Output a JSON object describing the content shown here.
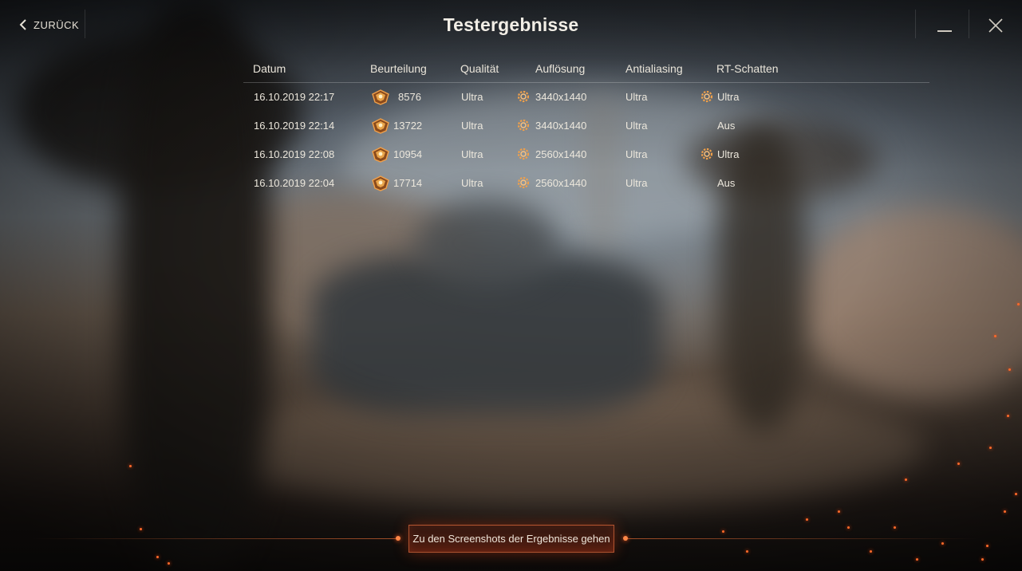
{
  "header": {
    "back_label": "ZURÜCK",
    "title": "Testergebnisse"
  },
  "table": {
    "columns": [
      "Datum",
      "Beurteilung",
      "Qualität",
      "Auflösung",
      "Antialiasing",
      "RT-Schatten"
    ],
    "rows": [
      {
        "date": "16.10.2019 22:17",
        "rating": "8576",
        "quality": "Ultra",
        "resolution": "3440x1440",
        "antialiasing": "Ultra",
        "rt_shadows": "Ultra",
        "rt_badge": true
      },
      {
        "date": "16.10.2019 22:14",
        "rating": "13722",
        "quality": "Ultra",
        "resolution": "3440x1440",
        "antialiasing": "Ultra",
        "rt_shadows": "Aus",
        "rt_badge": false
      },
      {
        "date": "16.10.2019 22:08",
        "rating": "10954",
        "quality": "Ultra",
        "resolution": "2560x1440",
        "antialiasing": "Ultra",
        "rt_shadows": "Ultra",
        "rt_badge": true
      },
      {
        "date": "16.10.2019 22:04",
        "rating": "17714",
        "quality": "Ultra",
        "resolution": "2560x1440",
        "antialiasing": "Ultra",
        "rt_shadows": "Aus",
        "rt_badge": false
      }
    ]
  },
  "footer": {
    "screenshots_button_label": "Zu den Screenshots der Ergebnisse gehen"
  },
  "icons": {
    "back": "chevron-left-icon",
    "minimize": "minimize-icon",
    "close": "close-icon",
    "rating": "medal-icon",
    "rt_feature": "gear-icon"
  },
  "colors": {
    "accent": "#d6683c",
    "icon_gold": "#f0a04a",
    "text": "#ece7dc"
  }
}
